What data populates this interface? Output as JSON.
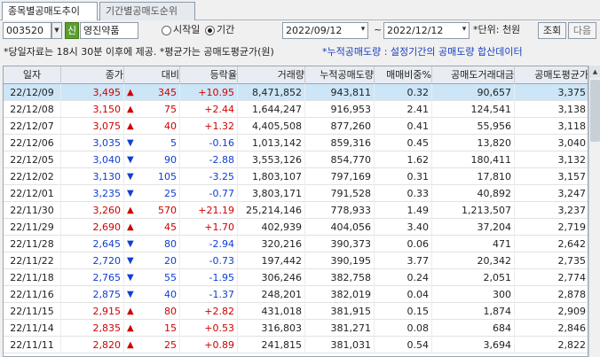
{
  "tabs": [
    {
      "label": "종목별공매도추이",
      "active": true
    },
    {
      "label": "기간별공매도순위",
      "active": false
    }
  ],
  "toolbar": {
    "code": "003520",
    "code_badge": "신",
    "stock_name": "영진약품",
    "radio_time": "시작일",
    "radio_period": "기간",
    "period_selected": true,
    "date_from": "2022/09/12",
    "date_to": "2022/12/12",
    "tilde": "~",
    "unit_label": "*단위: 천원",
    "query_label": "조회",
    "next_label": "다음"
  },
  "notes": {
    "left": "*당일자료는 18시 30분 이후에 제공. *평균가는 공매도평균가(원)",
    "right": "*누적공매도량 : 설정기간의 공매도량 합산데이터"
  },
  "colors": {
    "up": "#d10000",
    "down": "#1040d0",
    "selected_row": "#cce6f7"
  },
  "table": {
    "headers": [
      "일자",
      "종가",
      "대비",
      "등락율",
      "거래량",
      "누적공매도량",
      "매매비중%",
      "공매도거래대금",
      "공매도평균가"
    ],
    "rows": [
      {
        "date": "22/12/09",
        "close": "3,495",
        "dir": "up",
        "change": "345",
        "rate": "+10.95",
        "volume": "8,471,852",
        "cum_short": "943,811",
        "ratio": "0.32",
        "short_amount": "90,657",
        "short_avg": "3,375"
      },
      {
        "date": "22/12/08",
        "close": "3,150",
        "dir": "up",
        "change": "75",
        "rate": "+2.44",
        "volume": "1,644,247",
        "cum_short": "916,953",
        "ratio": "2.41",
        "short_amount": "124,541",
        "short_avg": "3,138"
      },
      {
        "date": "22/12/07",
        "close": "3,075",
        "dir": "up",
        "change": "40",
        "rate": "+1.32",
        "volume": "4,405,508",
        "cum_short": "877,260",
        "ratio": "0.41",
        "short_amount": "55,956",
        "short_avg": "3,118"
      },
      {
        "date": "22/12/06",
        "close": "3,035",
        "dir": "down",
        "change": "5",
        "rate": "-0.16",
        "volume": "1,013,142",
        "cum_short": "859,316",
        "ratio": "0.45",
        "short_amount": "13,820",
        "short_avg": "3,040"
      },
      {
        "date": "22/12/05",
        "close": "3,040",
        "dir": "down",
        "change": "90",
        "rate": "-2.88",
        "volume": "3,553,126",
        "cum_short": "854,770",
        "ratio": "1.62",
        "short_amount": "180,411",
        "short_avg": "3,132"
      },
      {
        "date": "22/12/02",
        "close": "3,130",
        "dir": "down",
        "change": "105",
        "rate": "-3.25",
        "volume": "1,803,107",
        "cum_short": "797,169",
        "ratio": "0.31",
        "short_amount": "17,810",
        "short_avg": "3,157"
      },
      {
        "date": "22/12/01",
        "close": "3,235",
        "dir": "down",
        "change": "25",
        "rate": "-0.77",
        "volume": "3,803,171",
        "cum_short": "791,528",
        "ratio": "0.33",
        "short_amount": "40,892",
        "short_avg": "3,247"
      },
      {
        "date": "22/11/30",
        "close": "3,260",
        "dir": "up",
        "change": "570",
        "rate": "+21.19",
        "volume": "25,214,146",
        "cum_short": "778,933",
        "ratio": "1.49",
        "short_amount": "1,213,507",
        "short_avg": "3,237"
      },
      {
        "date": "22/11/29",
        "close": "2,690",
        "dir": "up",
        "change": "45",
        "rate": "+1.70",
        "volume": "402,939",
        "cum_short": "404,056",
        "ratio": "3.40",
        "short_amount": "37,204",
        "short_avg": "2,719"
      },
      {
        "date": "22/11/28",
        "close": "2,645",
        "dir": "down",
        "change": "80",
        "rate": "-2.94",
        "volume": "320,216",
        "cum_short": "390,373",
        "ratio": "0.06",
        "short_amount": "471",
        "short_avg": "2,642"
      },
      {
        "date": "22/11/22",
        "close": "2,720",
        "dir": "down",
        "change": "20",
        "rate": "-0.73",
        "volume": "197,442",
        "cum_short": "390,195",
        "ratio": "3.77",
        "short_amount": "20,342",
        "short_avg": "2,735"
      },
      {
        "date": "22/11/18",
        "close": "2,765",
        "dir": "down",
        "change": "55",
        "rate": "-1.95",
        "volume": "306,246",
        "cum_short": "382,758",
        "ratio": "0.24",
        "short_amount": "2,051",
        "short_avg": "2,774"
      },
      {
        "date": "22/11/16",
        "close": "2,875",
        "dir": "down",
        "change": "40",
        "rate": "-1.37",
        "volume": "248,201",
        "cum_short": "382,019",
        "ratio": "0.04",
        "short_amount": "300",
        "short_avg": "2,878"
      },
      {
        "date": "22/11/15",
        "close": "2,915",
        "dir": "up",
        "change": "80",
        "rate": "+2.82",
        "volume": "431,018",
        "cum_short": "381,915",
        "ratio": "0.15",
        "short_amount": "1,874",
        "short_avg": "2,909"
      },
      {
        "date": "22/11/14",
        "close": "2,835",
        "dir": "up",
        "change": "15",
        "rate": "+0.53",
        "volume": "316,803",
        "cum_short": "381,271",
        "ratio": "0.08",
        "short_amount": "684",
        "short_avg": "2,846"
      },
      {
        "date": "22/11/11",
        "close": "2,820",
        "dir": "up",
        "change": "25",
        "rate": "+0.89",
        "volume": "241,815",
        "cum_short": "381,031",
        "ratio": "0.54",
        "short_amount": "3,694",
        "short_avg": "2,822"
      }
    ]
  }
}
